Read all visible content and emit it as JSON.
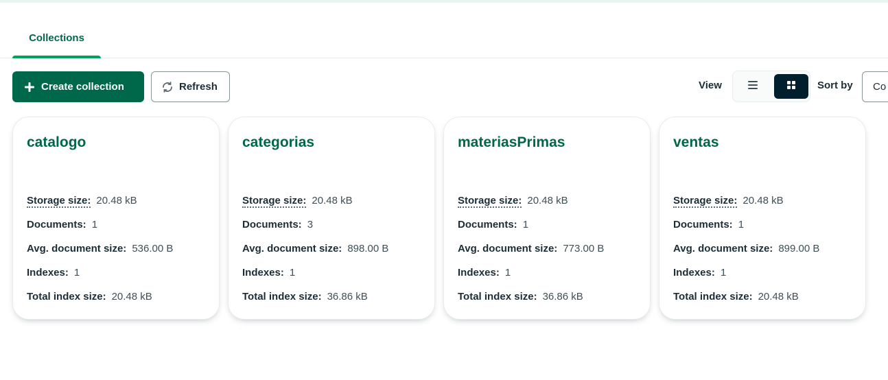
{
  "tabs": [
    {
      "label": "Collections",
      "active": true
    }
  ],
  "toolbar": {
    "create_label": "Create collection",
    "refresh_label": "Refresh",
    "view_label": "View",
    "view_options": [
      {
        "icon": "list-icon",
        "selected": false
      },
      {
        "icon": "grid-icon",
        "selected": true
      }
    ],
    "sort_label": "Sort by",
    "sort_value": "Co"
  },
  "labels": {
    "storage": "Storage size:",
    "documents": "Documents:",
    "avg_doc": "Avg. document size:",
    "indexes": "Indexes:",
    "total_index": "Total index size:"
  },
  "collections": [
    {
      "name": "catalogo",
      "storage": "20.48 kB",
      "documents": "1",
      "avg_doc": "536.00 B",
      "indexes": "1",
      "total_index": "20.48 kB"
    },
    {
      "name": "categorias",
      "storage": "20.48 kB",
      "documents": "3",
      "avg_doc": "898.00 B",
      "indexes": "1",
      "total_index": "36.86 kB"
    },
    {
      "name": "materiasPrimas",
      "storage": "20.48 kB",
      "documents": "1",
      "avg_doc": "773.00 B",
      "indexes": "1",
      "total_index": "36.86 kB"
    },
    {
      "name": "ventas",
      "storage": "20.48 kB",
      "documents": "1",
      "avg_doc": "899.00 B",
      "indexes": "1",
      "total_index": "20.48 kB"
    }
  ],
  "colors": {
    "brand": "#00684a",
    "accent": "#00a35c",
    "dark": "#001e2b"
  }
}
